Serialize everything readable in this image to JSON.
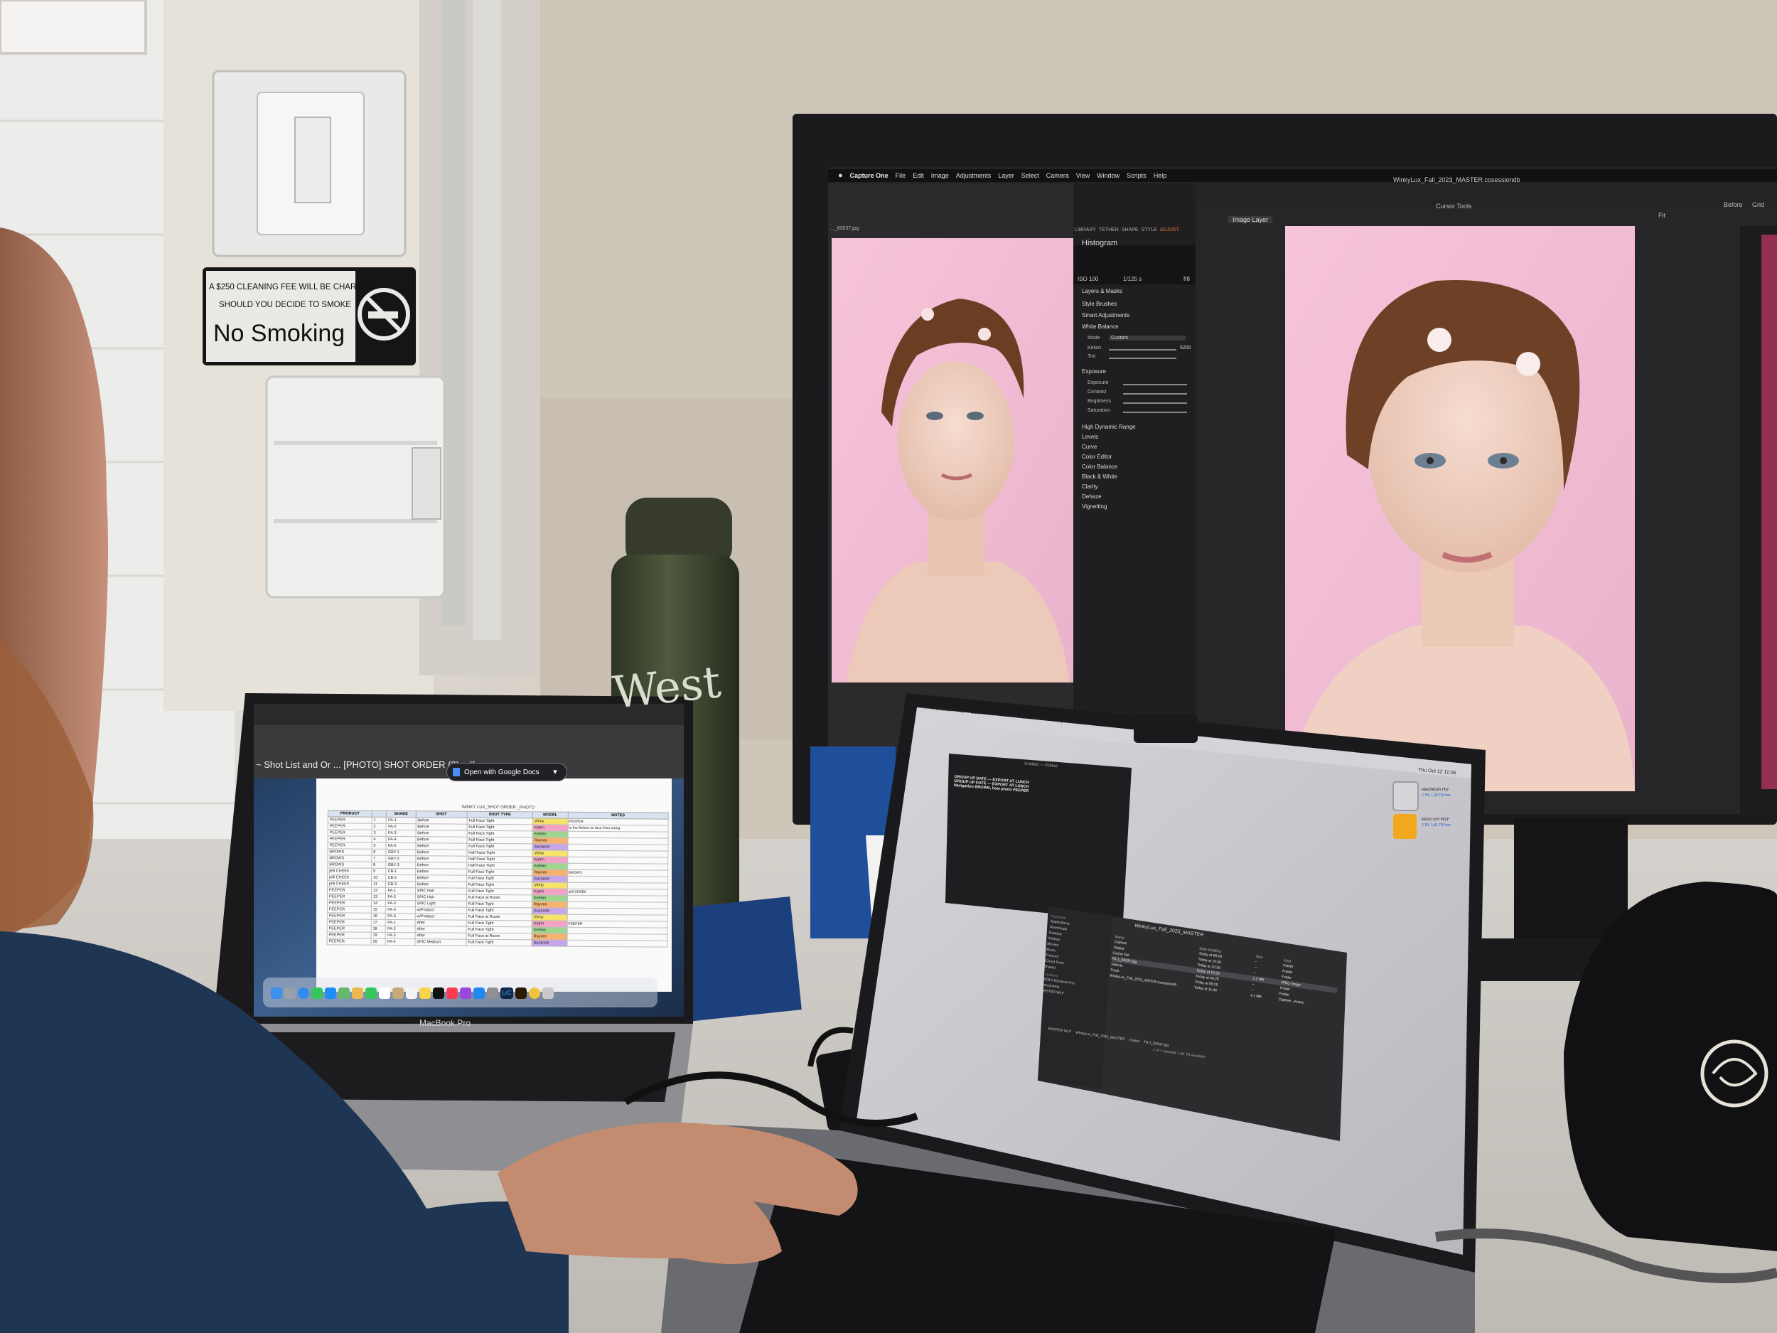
{
  "sign": {
    "line1": "A $250 CLEANING FEE WILL BE CHARGED",
    "line2": "SHOULD YOU DECIDE TO SMOKE",
    "title": "No Smoking"
  },
  "bottle": {
    "brand": "West"
  },
  "monitor": {
    "menubar": [
      "Capture One",
      "File",
      "Edit",
      "Image",
      "Adjustments",
      "Layer",
      "Select",
      "Camera",
      "View",
      "Window",
      "Scripts",
      "Help"
    ],
    "document_title": "WinkyLux_Fall_2023_MASTER.cosessiondb",
    "tool_tabs": [
      "LIBRARY",
      "TETHER",
      "SHAPE",
      "STYLE",
      "ADJUST"
    ],
    "layer_dropdown": "Image Layer",
    "histogram_title": "Histogram",
    "iso": "ISO 100",
    "shutter": "1/125 s",
    "aperture": "f/8",
    "panels": [
      "Layers & Masks",
      "Style Brushes",
      "Smart Adjustments",
      "White Balance",
      "Exposure",
      "High Dynamic Range",
      "Levels",
      "Curve",
      "Color Editor",
      "Color Balance",
      "Black & White",
      "Clarity",
      "Dehaze",
      "Vignetting"
    ],
    "wb_mode_label": "Mode",
    "wb_mode_value": "Custom",
    "kelvin_label": "Kelvin",
    "tint_label": "Tint",
    "kelvin_value": "5200",
    "exposure_sliders": [
      "Exposure",
      "Contrast",
      "Brightness",
      "Saturation"
    ],
    "thumbnail_filename": "..._83037.jpg",
    "right_toolbar": [
      "Before",
      "Grid"
    ],
    "cursor_tools_label": "Cursor Tools",
    "fit_label": "Fit"
  },
  "macbook_left": {
    "label": "MacBook Pro",
    "tab_title": "~ Shot List and Or ... [PHOTO] SHOT ORDER (3).pdf",
    "open_button": "Open with Google Docs",
    "sheet_title": "WINKY LUX_SHOT ORDER _PHOTO",
    "columns": [
      "PRODUCT",
      "",
      "SHADE",
      "SHOT",
      "SHOT TYPE",
      "MODEL",
      "NOTES"
    ],
    "rows": [
      [
        "PEEPER",
        "1",
        "FA-1",
        "Before",
        "Full Face Tight",
        "Vinny"
      ],
      [
        "PEEPER",
        "2",
        "FA-2",
        "Before",
        "Full Face Tight",
        "Katrin"
      ],
      [
        "PEEPER",
        "3",
        "FA-3",
        "Before",
        "Full Face Tight",
        "Keelan"
      ],
      [
        "PEEPER",
        "4",
        "FA-4",
        "Before",
        "Full Face Tight",
        "Rayven"
      ],
      [
        "PEEPER",
        "5",
        "FA-5",
        "Before",
        "Full Face Tight",
        "Suzanne"
      ],
      [
        "BROWS",
        "6",
        "GBY-1",
        "Before",
        "Half Face Tight",
        "Vinny"
      ],
      [
        "BROWS",
        "7",
        "GBY-2",
        "Before",
        "Half Face Tight",
        "Katrin"
      ],
      [
        "BROWS",
        "8",
        "GBY-3",
        "Before",
        "Half Face Tight",
        "Keelan"
      ],
      [
        "jelli CHEEK",
        "9",
        "CB-1",
        "Before",
        "Full Face Tight",
        "Rayven"
      ],
      [
        "jelli CHEEK",
        "10",
        "CB-2",
        "Before",
        "Full Face Tight",
        "Suzanne"
      ],
      [
        "jelli CHEEK",
        "11",
        "CB-3",
        "Before",
        "Full Face Tight",
        "Vinny"
      ],
      [
        "PEEPER",
        "12",
        "FA-1",
        "SPIC Hair",
        "Full Face Tight",
        "Katrin"
      ],
      [
        "PEEPER",
        "13",
        "FA-2",
        "SPIC Hair",
        "Full Face at Room",
        "Keelan"
      ],
      [
        "PEEPER",
        "14",
        "FA-3",
        "SPIC Light",
        "Full Face Tight",
        "Rayven"
      ],
      [
        "PEEPER",
        "15",
        "FA-4",
        "w/Product",
        "Full Face Tight",
        "Suzanne"
      ],
      [
        "PEEPER",
        "16",
        "FA-5",
        "w/Product",
        "Full Face at Room",
        "Vinny"
      ],
      [
        "PEEPER",
        "17",
        "FA-1",
        "After",
        "Full Face Tight",
        "Katrin"
      ],
      [
        "PEEPER",
        "18",
        "FA-2",
        "After",
        "Full Face Tight",
        "Keelan"
      ],
      [
        "PEEPER",
        "19",
        "FA-3",
        "After",
        "Full Face at Room",
        "Rayven"
      ],
      [
        "PEEPER",
        "20",
        "FA-4",
        "SPIC Medium",
        "Full Face Tight",
        "Suzanne"
      ]
    ],
    "notes": [
      "PEEPER",
      "to the Before on face from swing.",
      "BROWS",
      "jelli CHEEK",
      "PEEPER"
    ],
    "dock_label": "LrC"
  },
  "macbook_right": {
    "menubar": [
      "Preview",
      "File",
      "Edit",
      "View",
      "Go",
      "Tools",
      "Window",
      "Help"
    ],
    "notes_window": {
      "title": "Untitled — Edited",
      "lines": [
        "GROUP UP DATE — EXPORT AT LUNCH",
        "GROUP UP DATE — EXPORT AT LUNCH",
        "Navigation BROWN, how photo PEEPER"
      ]
    },
    "finder": {
      "title": "WinkyLux_Fall_2023_MASTER",
      "sidebar_header": "Favorites",
      "sidebar": [
        "Applications",
        "Downloads",
        "Desktop",
        "AirDrop",
        "Movies",
        "Music",
        "Pictures",
        "iCloud Drive",
        "Shared"
      ],
      "locations_header": "Locations",
      "locations": [
        "MCB's MacBook Pro",
        "Documents",
        "MASTER WLF"
      ],
      "columns": [
        "Name",
        "Date Modified",
        "Size",
        "Kind"
      ],
      "rows": [
        [
          "Capture",
          "Today at 09:29",
          "--",
          "Folder"
        ],
        [
          "Output",
          "Today at 10:30",
          "--",
          "Folder"
        ],
        [
          "Cache Dst",
          "Today at 10:30",
          "--",
          "Folder"
        ],
        [
          "FA-1_83037.jpg",
          "Today at 10:33",
          "1.2 MB",
          "JPEG image"
        ],
        [
          "Selects",
          "Today at 09:25",
          "--",
          "Folder"
        ],
        [
          "Trash",
          "Today at 09:25",
          "--",
          "Folder"
        ],
        [
          "WinkyLux_Fall_2023_ASTER.cosessiondb",
          "Today at 11:05",
          "4.1 MB",
          "Capture...ession"
        ]
      ],
      "status": "1 of 7 selected, 1.81 TB available",
      "path": [
        "MASTER WLF",
        "WinkyLux_Fall_2023_MASTER",
        "Output",
        "FA-1_83037.jpg"
      ]
    },
    "desktop_items": [
      {
        "name": "Macintosh HD",
        "info": "2 TB, 1,33 TB free"
      },
      {
        "name": "MASTER WLF",
        "info": "2 TB, 1,81 TB free"
      }
    ],
    "clock": "Thu Oct 12  11:06"
  },
  "colors": {
    "wall": "#d8d1c6",
    "backdrop_pink": "#f2bfd6",
    "monitor_bezel": "#1b1b1d",
    "app_panel": "#2a2a2c",
    "highlight_orange": "#e7772a",
    "sweater_blue": "#1f3554",
    "desktop_gray": "#c9c8cd"
  }
}
